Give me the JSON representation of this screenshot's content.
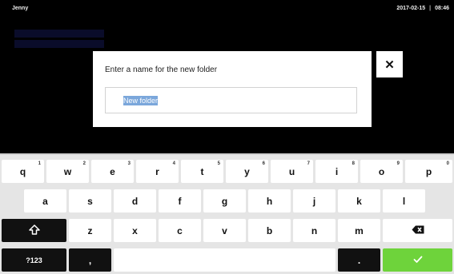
{
  "status": {
    "user": "Jenny",
    "date": "2017-02-15",
    "separator": "|",
    "time": "08:46"
  },
  "dialog": {
    "title": "Enter a name for the new folder",
    "input_value": "New folder",
    "close_icon": "close-icon"
  },
  "keyboard": {
    "row1": [
      {
        "label": "q",
        "hint": "1"
      },
      {
        "label": "w",
        "hint": "2"
      },
      {
        "label": "e",
        "hint": "3"
      },
      {
        "label": "r",
        "hint": "4"
      },
      {
        "label": "t",
        "hint": "5"
      },
      {
        "label": "y",
        "hint": "6"
      },
      {
        "label": "u",
        "hint": "7"
      },
      {
        "label": "i",
        "hint": "8"
      },
      {
        "label": "o",
        "hint": "9"
      },
      {
        "label": "p",
        "hint": "0"
      }
    ],
    "row2": [
      "a",
      "s",
      "d",
      "f",
      "g",
      "h",
      "j",
      "k",
      "l"
    ],
    "row3": [
      "z",
      "x",
      "c",
      "v",
      "b",
      "n",
      "m"
    ],
    "shift_icon": "shift-icon",
    "backspace_icon": "backspace-icon",
    "numbers_label": "?123",
    "comma_label": ",",
    "period_label": ".",
    "enter_icon": "checkmark-icon",
    "accent_color": "#6ed33b"
  }
}
